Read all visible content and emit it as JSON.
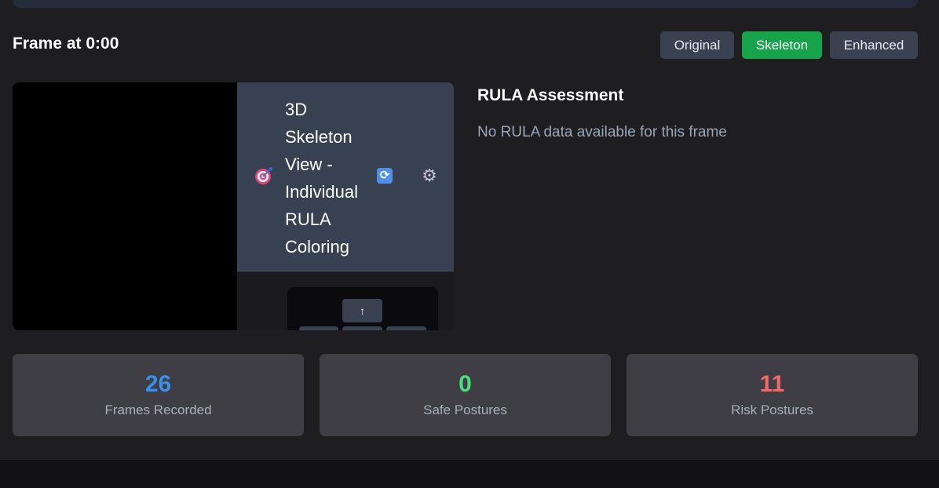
{
  "header": {
    "frame_title": "Frame at 0:00"
  },
  "view_toggle": {
    "original": "Original",
    "skeleton": "Skeleton",
    "enhanced": "Enhanced",
    "active": "Skeleton",
    "active_color": "#16a34a"
  },
  "skeleton_panel": {
    "title_lines": [
      "3D",
      "Skeleton",
      "View -",
      "Individual",
      "RULA",
      "Coloring"
    ],
    "icons": [
      "target-icon",
      "refresh-icon",
      "gear-icon"
    ],
    "controls": {
      "up_symbol": "↑"
    }
  },
  "rula": {
    "title": "RULA Assessment",
    "message": "No RULA data available for this frame"
  },
  "stats": [
    {
      "value": "26",
      "label": "Frames Recorded",
      "color": "#3b8fe8"
    },
    {
      "value": "0",
      "label": "Safe Postures",
      "color": "#4ade80"
    },
    {
      "value": "11",
      "label": "Risk Postures",
      "color": "#f06a6a"
    }
  ]
}
